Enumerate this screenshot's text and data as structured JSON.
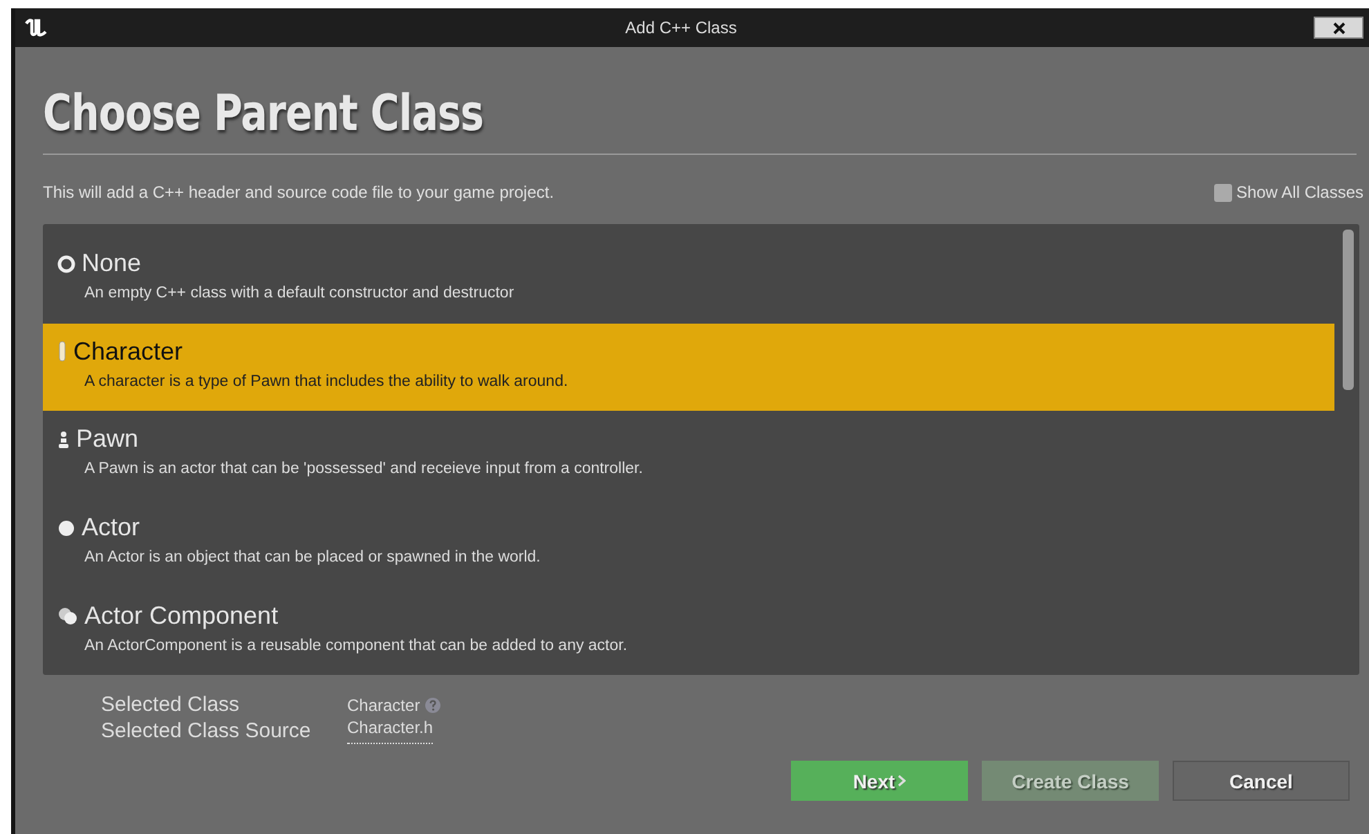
{
  "window": {
    "title": "Add C++ Class"
  },
  "heading": "Choose Parent Class",
  "description": "This will add a C++ header and source code file to your game project.",
  "show_all_classes": {
    "label": "Show All Classes",
    "checked": false
  },
  "classes": [
    {
      "kind": "none",
      "name": "None",
      "description": "An empty C++ class with a default constructor and destructor",
      "selected": false
    },
    {
      "kind": "character",
      "name": "Character",
      "description": "A character is a type of Pawn that includes the ability to walk around.",
      "selected": true
    },
    {
      "kind": "pawn",
      "name": "Pawn",
      "description": "A Pawn is an actor that can be 'possessed' and receieve input from a controller.",
      "selected": false
    },
    {
      "kind": "actor",
      "name": "Actor",
      "description": "An Actor is an object that can be placed or spawned in the world.",
      "selected": false
    },
    {
      "kind": "component",
      "name": "Actor Component",
      "description": "An ActorComponent is a reusable component that can be added to any actor.",
      "selected": false
    }
  ],
  "selected_info": [
    {
      "label": "Selected Class",
      "value": "Character",
      "kind": "class"
    },
    {
      "label": "Selected Class Source",
      "value": "Character.h",
      "kind": "link"
    }
  ],
  "buttons": [
    {
      "kind": "next",
      "label": "Next",
      "disabled": false
    },
    {
      "kind": "create",
      "label": "Create Class",
      "disabled": true
    },
    {
      "kind": "cancel",
      "label": "Cancel",
      "disabled": false
    }
  ]
}
